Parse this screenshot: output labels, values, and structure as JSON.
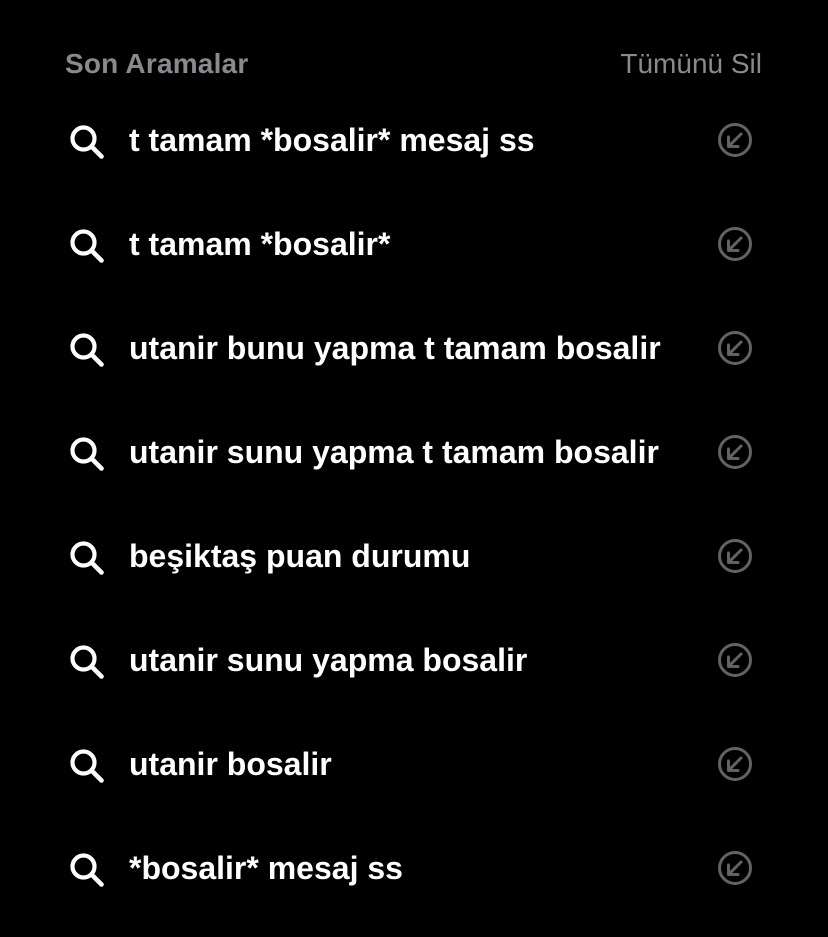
{
  "header": {
    "title": "Son Aramalar",
    "clear_all_label": "Tümünü Sil"
  },
  "recent_searches": [
    {
      "query": "t tamam *bosalir* mesaj ss"
    },
    {
      "query": "t tamam *bosalir*"
    },
    {
      "query": "utanir bunu yapma t tamam bosalir"
    },
    {
      "query": "utanir sunu yapma t tamam bosalir"
    },
    {
      "query": "beşiktaş puan durumu"
    },
    {
      "query": "utanir sunu yapma bosalir"
    },
    {
      "query": "utanir bosalir"
    },
    {
      "query": "*bosalir* mesaj ss"
    }
  ],
  "icons": {
    "leading": "search-icon",
    "trailing": "arrow-up-left-circle-icon"
  },
  "colors": {
    "background": "#000000",
    "primary_text": "#ffffff",
    "secondary_text": "#8a8a8e",
    "trailing_icon": "#636366"
  }
}
